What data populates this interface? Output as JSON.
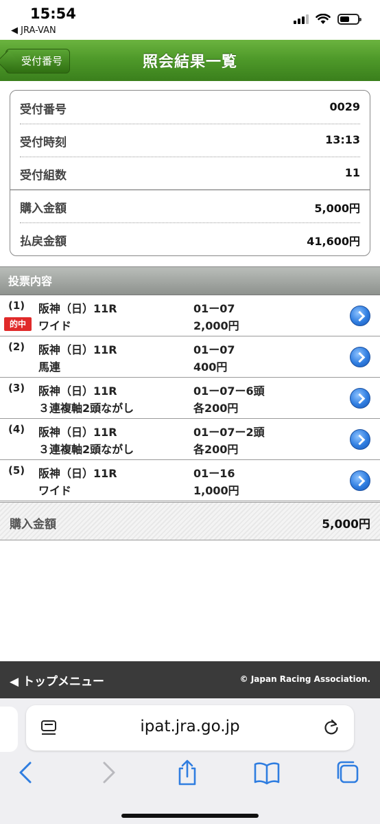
{
  "status_bar": {
    "time": "15:54",
    "back_app": "◀ JRA-VAN"
  },
  "header": {
    "back_label": "受付番号",
    "title": "照会結果一覧"
  },
  "summary": {
    "rows": [
      {
        "label": "受付番号",
        "value": "0029"
      },
      {
        "label": "受付時刻",
        "value": "13:13"
      },
      {
        "label": "受付組数",
        "value": "11"
      },
      {
        "label": "購入金額",
        "value": "5,000円"
      },
      {
        "label": "払戻金額",
        "value": "41,600円"
      }
    ]
  },
  "section_title": "投票内容",
  "bets": [
    {
      "num": "(1)",
      "race": "阪神（日）11R",
      "type": "ワイド",
      "combo": "01ー07",
      "amount": "2,000円",
      "hit": "的中"
    },
    {
      "num": "(2)",
      "race": "阪神（日）11R",
      "type": "馬連",
      "combo": "01ー07",
      "amount": "400円",
      "hit": ""
    },
    {
      "num": "(3)",
      "race": "阪神（日）11R",
      "type": "３連複軸2頭ながし",
      "combo": "01ー07ー6頭",
      "amount": "各200円",
      "hit": ""
    },
    {
      "num": "(4)",
      "race": "阪神（日）11R",
      "type": "３連複軸2頭ながし",
      "combo": "01ー07ー2頭",
      "amount": "各200円",
      "hit": ""
    },
    {
      "num": "(5)",
      "race": "阪神（日）11R",
      "type": "ワイド",
      "combo": "01ー16",
      "amount": "1,000円",
      "hit": ""
    }
  ],
  "total": {
    "label": "購入金額",
    "value": "5,000円"
  },
  "footer": {
    "menu_label": "◀ トップメニュー",
    "copyright": "© Japan Racing Association."
  },
  "browser": {
    "url": "ipat.jra.go.jp"
  },
  "colors": {
    "header_green": "#4f9a2a",
    "hit_red": "#e02a2a",
    "link_blue": "#2f7de0",
    "footer_dark": "#3a3a3a"
  }
}
